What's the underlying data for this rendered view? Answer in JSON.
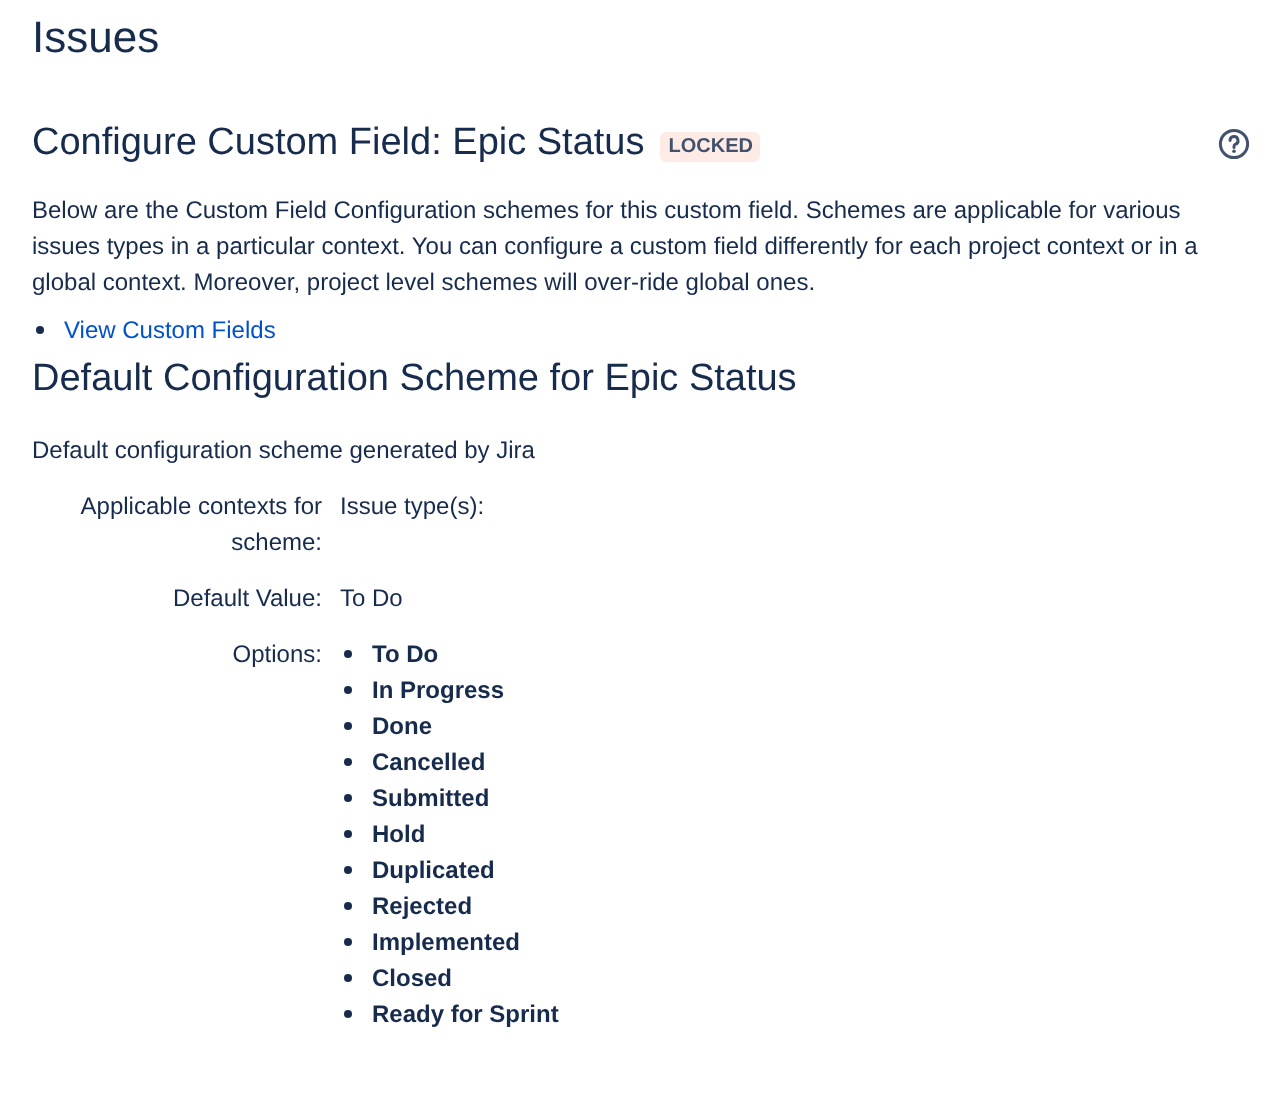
{
  "page_title": "Issues",
  "header": {
    "title": "Configure Custom Field: Epic Status",
    "badge": "LOCKED"
  },
  "description": "Below are the Custom Field Configuration schemes for this custom field. Schemes are applicable for various issues types in a particular context. You can configure a custom field differently for each project context or in a global context. Moreover, project level schemes will over-ride global ones.",
  "links": [
    "View Custom Fields"
  ],
  "scheme": {
    "title": "Default Configuration Scheme for Epic Status",
    "description": "Default configuration scheme generated by Jira",
    "rows": [
      {
        "kind": "text",
        "label": "Applicable contexts for scheme:",
        "value": "Issue type(s):"
      },
      {
        "kind": "text",
        "label": "Default Value:",
        "value": "To Do"
      },
      {
        "kind": "list",
        "label": "Options:",
        "items": [
          "To Do",
          "In Progress",
          "Done",
          "Cancelled",
          "Submitted",
          "Hold",
          "Duplicated",
          "Rejected",
          "Implemented",
          "Closed",
          "Ready for Sprint"
        ]
      }
    ]
  }
}
